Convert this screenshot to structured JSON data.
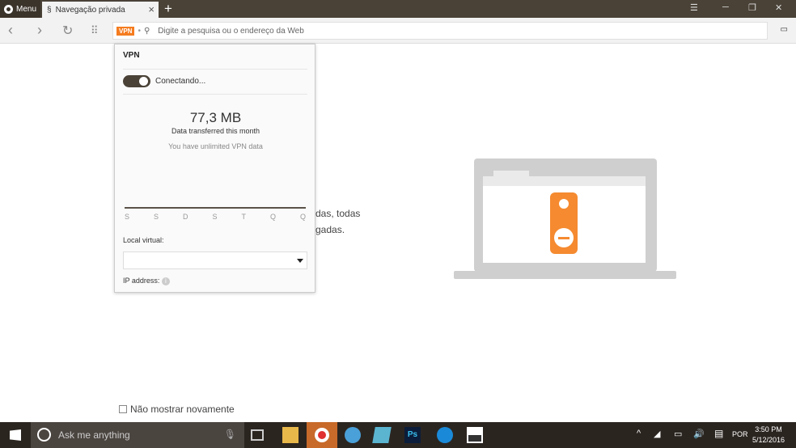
{
  "browser": {
    "menu_label": "Menu",
    "tab_title": "Navegação privada",
    "address_placeholder": "Digite a pesquisa ou o endereço da Web",
    "vpn_badge": "VPN"
  },
  "vpn_popup": {
    "title": "VPN",
    "status": "Conectando...",
    "data_amount": "77,3 MB",
    "data_caption": "Data transferred this month",
    "data_note": "You have unlimited VPN data",
    "days": [
      "S",
      "S",
      "D",
      "S",
      "T",
      "Q",
      "Q"
    ],
    "location_label": "Local virtual:",
    "location_value": "",
    "ip_label": "IP address:",
    "connected": true
  },
  "page": {
    "partial_line1": "das, todas",
    "partial_line2": "gadas.",
    "dont_show_label": "Não mostrar novamente"
  },
  "taskbar": {
    "search_placeholder": "Ask me anything",
    "language": "POR",
    "time": "3:50 PM",
    "date": "5/12/2016"
  },
  "colors": {
    "accent": "#f57c1f",
    "chrome": "#4a4237"
  }
}
